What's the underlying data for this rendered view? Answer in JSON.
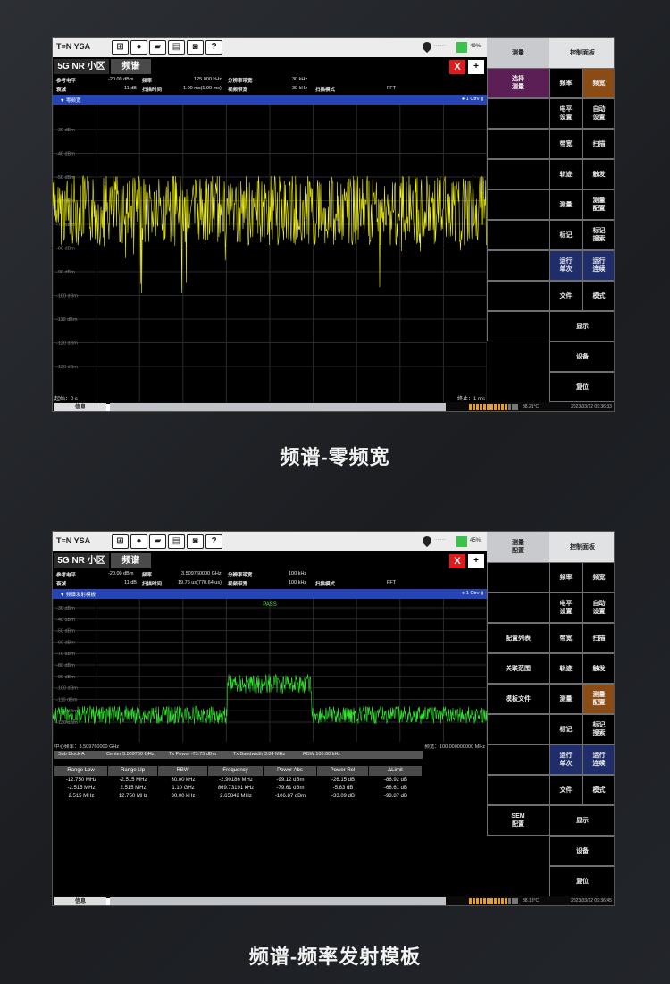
{
  "screen1": {
    "logo": "T≡N YSA",
    "toolbar_icons": [
      "windows-icon",
      "person-icon",
      "folder-icon",
      "save-icon",
      "camera-icon",
      "help-icon"
    ],
    "help_glyph": "?",
    "gps_text": "········",
    "battery": "49%",
    "tab_a": "5G NR 小区",
    "tab_b": "频谱",
    "close": "X",
    "add": "+",
    "params": [
      {
        "k": "参考电平",
        "v": "-20.00 dBm",
        "k2": "频率",
        "v2": "125.000 kHz",
        "k3": "分辨率带宽",
        "v3": "30 kHz"
      },
      {
        "k": "衰减",
        "v": "11 dB",
        "k2": "扫描时间",
        "v2": "1.00 ms(1.00 ms)",
        "k3": "视频带宽",
        "v3": "30 kHz",
        "k4": "扫描模式",
        "v4": "FFT"
      }
    ],
    "plot_title": "▼ 零频宽",
    "plot_right": "● 1 Ctrv ▮",
    "y_ticks": [
      "-30 dBm",
      "-40 dBm",
      "-50 dBm",
      "-60 dBm",
      "-70 dBm",
      "-80 dBm",
      "-90 dBm",
      "-100 dBm",
      "-110 dBm",
      "-120 dBm",
      "-130 dBm"
    ],
    "start_label": "起始：0 s",
    "stop_label": "终止：1 ms",
    "info": "信息",
    "temp": "38.21°C",
    "date": "2023/03/12 09:36:33",
    "panel_head_left": "测量",
    "panel_head_right": "控制面板",
    "left_cells": [
      "选择\n测量",
      "",
      "",
      "",
      "",
      "",
      "",
      "",
      ""
    ],
    "right_cells": [
      [
        "频率",
        "频宽"
      ],
      [
        "电平\n设置",
        "自动\n设置"
      ],
      [
        "带宽",
        "扫描"
      ],
      [
        "轨迹",
        "触发"
      ],
      [
        "测量",
        "测量\n配置"
      ],
      [
        "标记",
        "标记\n搜索"
      ],
      [
        "运行\n单次",
        "运行\n连续"
      ],
      [
        "文件",
        "模式"
      ]
    ],
    "wide_cells": [
      "显示",
      "设备",
      "复位"
    ]
  },
  "caption1": "频谱-零频宽",
  "screen2": {
    "logo": "T≡N YSA",
    "help_glyph": "?",
    "gps_text": "········",
    "battery": "45%",
    "tab_a": "5G NR 小区",
    "tab_b": "频谱",
    "close": "X",
    "add": "+",
    "params": [
      {
        "k": "参考电平",
        "v": "-20.00 dBm",
        "k2": "频率",
        "v2": "3.509760000 GHz",
        "k3": "分辨率带宽",
        "v3": "100 kHz"
      },
      {
        "k": "衰减",
        "v": "11 dB",
        "k2": "扫描时间",
        "v2": "19.76 us(770.64 us)",
        "k3": "视频带宽",
        "v3": "100 kHz",
        "k4": "扫描模式",
        "v4": "FFT"
      }
    ],
    "plot_title": "▼ 频谱发射模板",
    "plot_right": "● 1 Ctrv ▮",
    "pass": "PASS",
    "y_ticks": [
      "-30 dBm",
      "-40 dBm",
      "-50 dBm",
      "-60 dBm",
      "-70 dBm",
      "-80 dBm",
      "-90 dBm",
      "-100 dBm",
      "-110 dBm",
      "-120 dBm",
      "-130 dBm"
    ],
    "center_label": "中心频率：3.509760000 GHz",
    "span_label": "频宽：100.000000000 MHz",
    "sem_header": {
      "block": "Sub Block A",
      "center": "Center  3.509760 GHz",
      "txpower": "Tx Power  -73.75 dBm",
      "txbw": "Tx Bandwidth  3.84 MHz",
      "rbw": "RBW  100.00 kHz"
    },
    "sem_columns": [
      "Range Low",
      "Range Up",
      "RBW",
      "Frequency",
      "Power Abs",
      "Power Rel",
      "ΔLimit"
    ],
    "sem_rows": [
      [
        "-12.750 MHz",
        "-2.515 MHz",
        "30.00 kHz",
        "-2.90186 MHz",
        "-99.12 dBm",
        "-26.15 dB",
        "-86.92 dB"
      ],
      [
        "-2.515 MHz",
        "2.515 MHz",
        "1.10 GHz",
        "869.73191 kHz",
        "-79.61 dBm",
        "-5.83 dB",
        "-66.61 dB"
      ],
      [
        "2.515 MHz",
        "12.750 MHz",
        "30.00 kHz",
        "2.65842 MHz",
        "-106.87 dBm",
        "-33.09 dB",
        "-93.87 dB"
      ]
    ],
    "info": "信息",
    "temp": "38.13°C",
    "date": "2023/03/12 09:36:45",
    "panel_head_left": "测量\n配置",
    "panel_head_right": "控制面板",
    "left_cells": [
      "",
      "",
      "配置列表",
      "关联范围",
      "模板文件",
      "",
      "",
      "",
      "SEM\n配置"
    ],
    "right_cells": [
      [
        "频率",
        "频宽"
      ],
      [
        "电平\n设置",
        "自动\n设置"
      ],
      [
        "带宽",
        "扫描"
      ],
      [
        "轨迹",
        "触发"
      ],
      [
        "测量",
        "测量\n配置"
      ],
      [
        "标记",
        "标记\n搜索"
      ],
      [
        "运行\n单次",
        "运行\n连续"
      ],
      [
        "文件",
        "模式"
      ]
    ],
    "wide_cells": [
      "显示",
      "设备",
      "复位"
    ]
  },
  "caption2": "频谱-频率发射模板",
  "colors": {
    "trace1": "#f2f21a",
    "trace2": "#33e533",
    "accent_bar": "#2545b6",
    "close": "#e11b1b"
  }
}
